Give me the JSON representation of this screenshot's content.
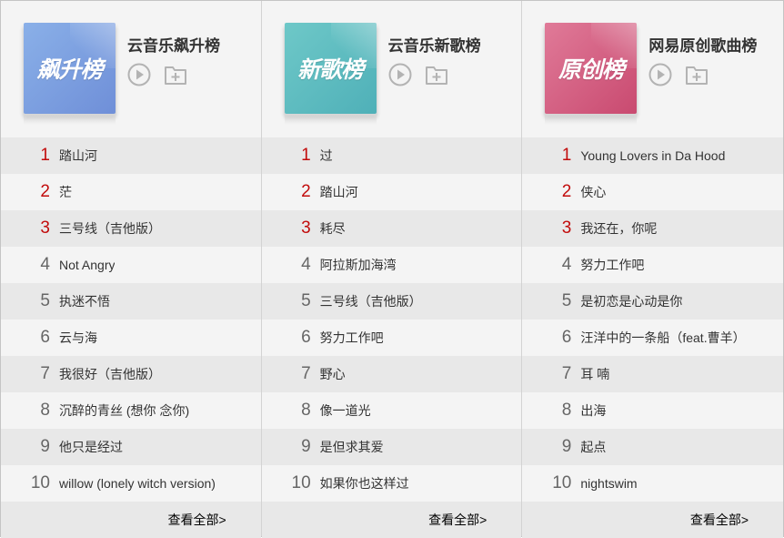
{
  "boards": [
    {
      "cover_text": "飙升榜",
      "title": "云音乐飙升榜",
      "more": "查看全部>",
      "songs": [
        {
          "rank": "1",
          "name": "踏山河"
        },
        {
          "rank": "2",
          "name": "茫"
        },
        {
          "rank": "3",
          "name": "三号线（吉他版）"
        },
        {
          "rank": "4",
          "name": "Not Angry"
        },
        {
          "rank": "5",
          "name": "执迷不悟"
        },
        {
          "rank": "6",
          "name": "云与海"
        },
        {
          "rank": "7",
          "name": "我很好（吉他版）"
        },
        {
          "rank": "8",
          "name": "沉醉的青丝 (想你 念你)"
        },
        {
          "rank": "9",
          "name": "他只是经过"
        },
        {
          "rank": "10",
          "name": "willow (lonely witch version)"
        }
      ]
    },
    {
      "cover_text": "新歌榜",
      "title": "云音乐新歌榜",
      "more": "查看全部>",
      "songs": [
        {
          "rank": "1",
          "name": "过"
        },
        {
          "rank": "2",
          "name": "踏山河"
        },
        {
          "rank": "3",
          "name": "耗尽"
        },
        {
          "rank": "4",
          "name": "阿拉斯加海湾"
        },
        {
          "rank": "5",
          "name": "三号线（吉他版）"
        },
        {
          "rank": "6",
          "name": "努力工作吧"
        },
        {
          "rank": "7",
          "name": "野心"
        },
        {
          "rank": "8",
          "name": "像一道光"
        },
        {
          "rank": "9",
          "name": "是但求其爱"
        },
        {
          "rank": "10",
          "name": "如果你也这样过"
        }
      ]
    },
    {
      "cover_text": "原创榜",
      "title": "网易原创歌曲榜",
      "more": "查看全部>",
      "songs": [
        {
          "rank": "1",
          "name": "Young Lovers in Da Hood"
        },
        {
          "rank": "2",
          "name": "侠心"
        },
        {
          "rank": "3",
          "name": "我还在，你呢"
        },
        {
          "rank": "4",
          "name": "努力工作吧"
        },
        {
          "rank": "5",
          "name": "是初恋是心动是你"
        },
        {
          "rank": "6",
          "name": "汪洋中的一条船（feat.曹羊）"
        },
        {
          "rank": "7",
          "name": "耳 喃"
        },
        {
          "rank": "8",
          "name": "出海"
        },
        {
          "rank": "9",
          "name": "起点"
        },
        {
          "rank": "10",
          "name": "nightswim"
        }
      ]
    }
  ],
  "icons": {
    "play": "play-icon",
    "add_to_playlist": "add-folder-icon"
  },
  "colors": {
    "top_rank": "#c20c0c",
    "rank": "#666666",
    "odd_row": "#e8e8e8",
    "even_row": "#f4f4f4"
  }
}
